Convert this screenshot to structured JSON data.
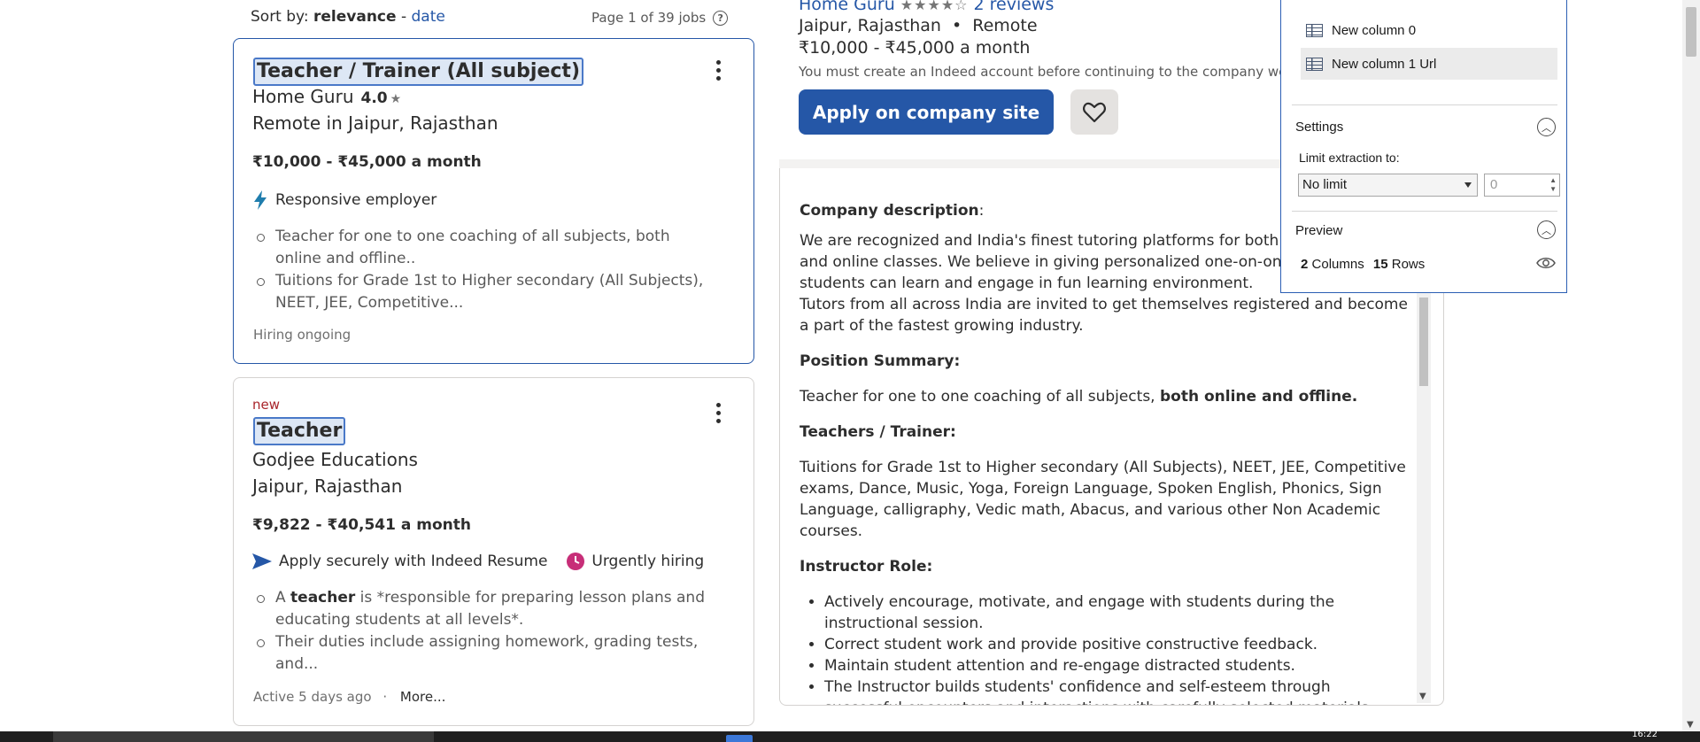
{
  "sort": {
    "prefix": "Sort by:",
    "active": "relevance",
    "separator": "-",
    "alternate": "date"
  },
  "pagination": {
    "text": "Page 1 of 39 jobs",
    "help_icon": "?"
  },
  "jobs": [
    {
      "title": "Teacher / Trainer (All subject)",
      "company": "Home Guru",
      "rating": "4.0",
      "location": "Remote in Jaipur, Rajasthan",
      "salary": "₹10,000 - ₹45,000 a month",
      "attribute": "Responsive employer",
      "bullets": [
        "Teacher for one to one coaching of all subjects, both online and offline..",
        "Tuitions for Grade 1st to Higher secondary (All Subjects), NEET, JEE, Competitive..."
      ],
      "footer": "Hiring ongoing"
    },
    {
      "badge": "new",
      "title": "Teacher",
      "company": "Godjee Educations",
      "location": "Jaipur, Rajasthan",
      "salary": "₹9,822 - ₹40,541 a month",
      "attribute": "Apply securely with Indeed Resume",
      "attribute2": "Urgently hiring",
      "bullet1_pre": "A ",
      "bullet1_bold": "teacher",
      "bullet1_post": " is *responsible for preparing lesson plans and educating students at all levels*.",
      "bullet2": "Their duties include assigning homework, grading tests, and...",
      "footer": "Active 5 days ago",
      "footer_sep": "·",
      "more": "More..."
    }
  ],
  "detail": {
    "company_link": "Home Guru",
    "stars": "★★★★☆",
    "reviews": "2 reviews",
    "location": "Jaipur, Rajasthan",
    "bullet_sep": "•",
    "remote": "Remote",
    "salary": "₹10,000 - ₹45,000 a month",
    "note": "You must create an Indeed account before continuing to the company website",
    "apply_button": "Apply on company site",
    "description": {
      "company_heading": "Company description",
      "company_colon": ":",
      "company_p1": "We are recognized and India's finest tutoring platforms for both home tuition and online classes. We believe in giving personalized one-on-one learning so students can learn and engage in fun learning environment.",
      "company_p2": "Tutors from all across India are invited to get themselves registered and become a part of the fastest growing industry.",
      "position_heading": "Position Summary:",
      "position_text": "Teacher for one to one coaching of all subjects, ",
      "position_bold": "both online and offline.",
      "trainer_heading": "Teachers / Trainer:",
      "trainer_text": "Tuitions for Grade 1st to Higher secondary (All Subjects), NEET, JEE, Competitive exams, Dance, Music, Yoga, Foreign Language, Spoken English, Phonics, Sign Language, calligraphy, Vedic math, Abacus, and various other Non Academic courses.",
      "instructor_heading": "Instructor Role:",
      "instructor_items": [
        "Actively encourage, motivate, and engage with students during the instructional session.",
        "Correct student work and provide positive constructive feedback.",
        "Maintain student attention and re-engage distracted students.",
        "The Instructor builds students' confidence and self-esteem through successful encounters and interactions with carefully selected materials"
      ]
    }
  },
  "extension": {
    "columns": [
      "New column 0",
      "New column 1 Url"
    ],
    "settings_title": "Settings",
    "limit_label": "Limit extraction to:",
    "limit_value": "No limit",
    "limit_number": "0",
    "preview_title": "Preview",
    "columns_count": "2",
    "columns_label": "Columns",
    "rows_count": "15",
    "rows_label": "Rows"
  },
  "taskbar": {
    "clock": "16:22"
  },
  "colors": {
    "link": "#2557a7",
    "apply_button": "#2557a7",
    "new_badge": "#a9252b",
    "urgent": "#c72e78",
    "extension_border": "#2b5fb4"
  }
}
